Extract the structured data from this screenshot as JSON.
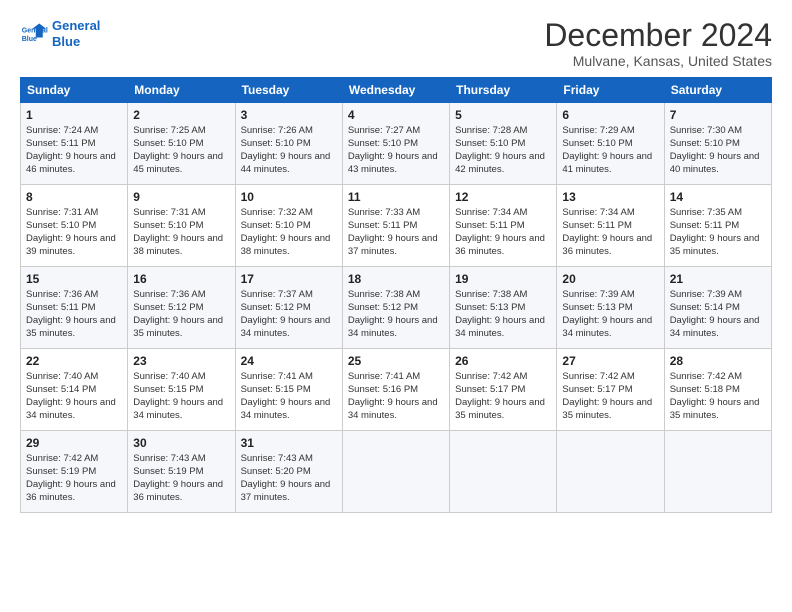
{
  "logo": {
    "line1": "General",
    "line2": "Blue"
  },
  "title": "December 2024",
  "location": "Mulvane, Kansas, United States",
  "headers": [
    "Sunday",
    "Monday",
    "Tuesday",
    "Wednesday",
    "Thursday",
    "Friday",
    "Saturday"
  ],
  "weeks": [
    [
      {
        "day": "1",
        "sunrise": "7:24 AM",
        "sunset": "5:11 PM",
        "daylight": "9 hours and 46 minutes."
      },
      {
        "day": "2",
        "sunrise": "7:25 AM",
        "sunset": "5:10 PM",
        "daylight": "9 hours and 45 minutes."
      },
      {
        "day": "3",
        "sunrise": "7:26 AM",
        "sunset": "5:10 PM",
        "daylight": "9 hours and 44 minutes."
      },
      {
        "day": "4",
        "sunrise": "7:27 AM",
        "sunset": "5:10 PM",
        "daylight": "9 hours and 43 minutes."
      },
      {
        "day": "5",
        "sunrise": "7:28 AM",
        "sunset": "5:10 PM",
        "daylight": "9 hours and 42 minutes."
      },
      {
        "day": "6",
        "sunrise": "7:29 AM",
        "sunset": "5:10 PM",
        "daylight": "9 hours and 41 minutes."
      },
      {
        "day": "7",
        "sunrise": "7:30 AM",
        "sunset": "5:10 PM",
        "daylight": "9 hours and 40 minutes."
      }
    ],
    [
      {
        "day": "8",
        "sunrise": "7:31 AM",
        "sunset": "5:10 PM",
        "daylight": "9 hours and 39 minutes."
      },
      {
        "day": "9",
        "sunrise": "7:31 AM",
        "sunset": "5:10 PM",
        "daylight": "9 hours and 38 minutes."
      },
      {
        "day": "10",
        "sunrise": "7:32 AM",
        "sunset": "5:10 PM",
        "daylight": "9 hours and 38 minutes."
      },
      {
        "day": "11",
        "sunrise": "7:33 AM",
        "sunset": "5:11 PM",
        "daylight": "9 hours and 37 minutes."
      },
      {
        "day": "12",
        "sunrise": "7:34 AM",
        "sunset": "5:11 PM",
        "daylight": "9 hours and 36 minutes."
      },
      {
        "day": "13",
        "sunrise": "7:34 AM",
        "sunset": "5:11 PM",
        "daylight": "9 hours and 36 minutes."
      },
      {
        "day": "14",
        "sunrise": "7:35 AM",
        "sunset": "5:11 PM",
        "daylight": "9 hours and 35 minutes."
      }
    ],
    [
      {
        "day": "15",
        "sunrise": "7:36 AM",
        "sunset": "5:11 PM",
        "daylight": "9 hours and 35 minutes."
      },
      {
        "day": "16",
        "sunrise": "7:36 AM",
        "sunset": "5:12 PM",
        "daylight": "9 hours and 35 minutes."
      },
      {
        "day": "17",
        "sunrise": "7:37 AM",
        "sunset": "5:12 PM",
        "daylight": "9 hours and 34 minutes."
      },
      {
        "day": "18",
        "sunrise": "7:38 AM",
        "sunset": "5:12 PM",
        "daylight": "9 hours and 34 minutes."
      },
      {
        "day": "19",
        "sunrise": "7:38 AM",
        "sunset": "5:13 PM",
        "daylight": "9 hours and 34 minutes."
      },
      {
        "day": "20",
        "sunrise": "7:39 AM",
        "sunset": "5:13 PM",
        "daylight": "9 hours and 34 minutes."
      },
      {
        "day": "21",
        "sunrise": "7:39 AM",
        "sunset": "5:14 PM",
        "daylight": "9 hours and 34 minutes."
      }
    ],
    [
      {
        "day": "22",
        "sunrise": "7:40 AM",
        "sunset": "5:14 PM",
        "daylight": "9 hours and 34 minutes."
      },
      {
        "day": "23",
        "sunrise": "7:40 AM",
        "sunset": "5:15 PM",
        "daylight": "9 hours and 34 minutes."
      },
      {
        "day": "24",
        "sunrise": "7:41 AM",
        "sunset": "5:15 PM",
        "daylight": "9 hours and 34 minutes."
      },
      {
        "day": "25",
        "sunrise": "7:41 AM",
        "sunset": "5:16 PM",
        "daylight": "9 hours and 34 minutes."
      },
      {
        "day": "26",
        "sunrise": "7:42 AM",
        "sunset": "5:17 PM",
        "daylight": "9 hours and 35 minutes."
      },
      {
        "day": "27",
        "sunrise": "7:42 AM",
        "sunset": "5:17 PM",
        "daylight": "9 hours and 35 minutes."
      },
      {
        "day": "28",
        "sunrise": "7:42 AM",
        "sunset": "5:18 PM",
        "daylight": "9 hours and 35 minutes."
      }
    ],
    [
      {
        "day": "29",
        "sunrise": "7:42 AM",
        "sunset": "5:19 PM",
        "daylight": "9 hours and 36 minutes."
      },
      {
        "day": "30",
        "sunrise": "7:43 AM",
        "sunset": "5:19 PM",
        "daylight": "9 hours and 36 minutes."
      },
      {
        "day": "31",
        "sunrise": "7:43 AM",
        "sunset": "5:20 PM",
        "daylight": "9 hours and 37 minutes."
      },
      null,
      null,
      null,
      null
    ]
  ]
}
